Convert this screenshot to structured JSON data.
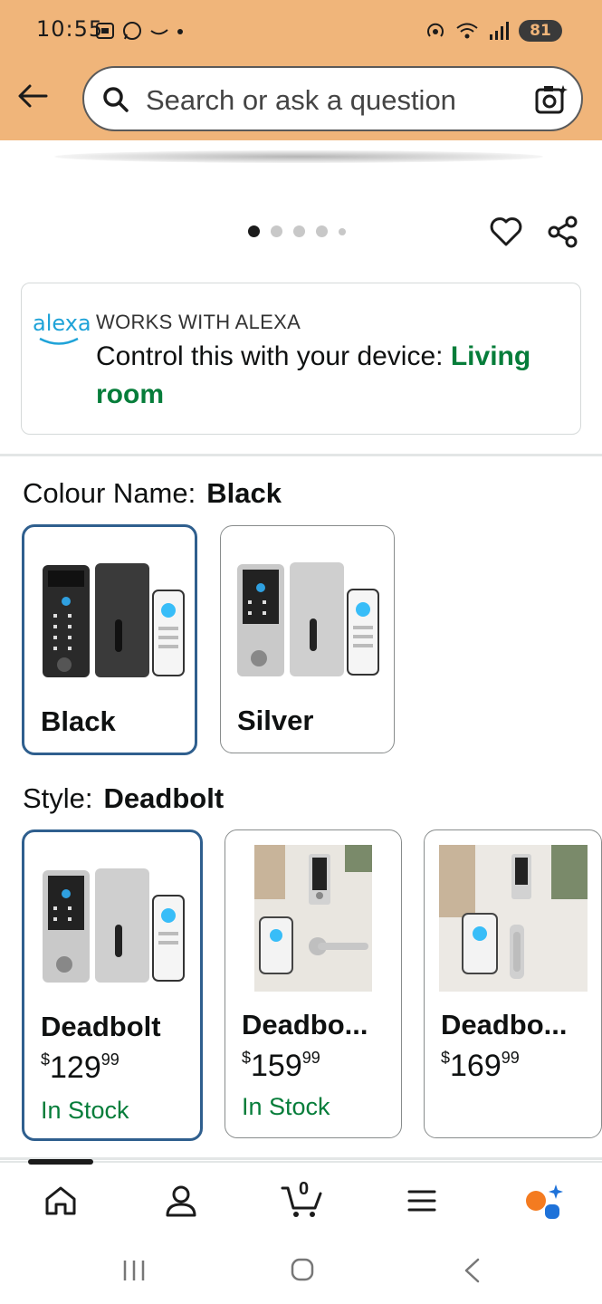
{
  "status": {
    "time": "10:55",
    "battery": "81"
  },
  "search": {
    "placeholder": "Search or ask a question"
  },
  "gallery": {
    "dots_total": 5,
    "active_index": 0
  },
  "alexa": {
    "logo_text": "alexa",
    "heading": "WORKS WITH ALEXA",
    "body_prefix": "Control this with your device: ",
    "device_link": "Living room"
  },
  "colour": {
    "label": "Colour Name:",
    "selected": "Black",
    "options": [
      {
        "title": "Black"
      },
      {
        "title": "Silver"
      }
    ]
  },
  "style": {
    "label": "Style:",
    "selected": "Deadbolt",
    "options": [
      {
        "title": "Deadbolt",
        "currency": "$",
        "price_whole": "129",
        "price_fraction": "99",
        "stock": "In Stock"
      },
      {
        "title": "Deadbo...",
        "currency": "$",
        "price_whole": "159",
        "price_fraction": "99",
        "stock": "In Stock"
      },
      {
        "title": "Deadbo...",
        "currency": "$",
        "price_whole": "169",
        "price_fraction": "99",
        "stock": ""
      }
    ]
  },
  "nav": {
    "cart_count": "0",
    "items": [
      "home-icon",
      "account-icon",
      "cart-icon",
      "menu-icon",
      "rufus-icon"
    ]
  },
  "colors": {
    "header_bg": "#f0b57a",
    "selected_border": "#2f5f8e",
    "stock_green": "#067d3a",
    "alexa_blue": "#1fa3d8"
  }
}
